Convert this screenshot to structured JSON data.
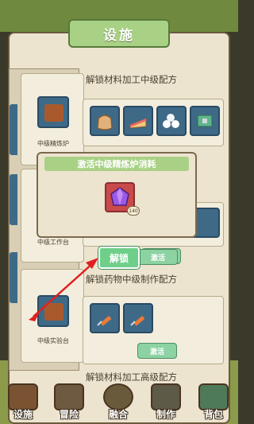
{
  "header": {
    "title": "设施"
  },
  "facilities": [
    {
      "label": "中级精炼炉"
    },
    {
      "label": "中级工作台"
    },
    {
      "label": "中级实验台"
    }
  ],
  "recipes": [
    {
      "title": "解锁材料加工中级配方"
    },
    {
      "title": "解锁药物中级制作配方",
      "activate_label": "激活"
    },
    {
      "title": "解锁材料加工高级配方"
    }
  ],
  "recipe2_activate": "激活",
  "popup": {
    "title": "激活中级精炼炉消耗",
    "item_icon": "purple-gem-icon",
    "count": "140",
    "unlock_label": "解锁",
    "activate_label": "激活"
  },
  "nav": [
    {
      "label": "设施",
      "icon": "facility-icon"
    },
    {
      "label": "冒险",
      "icon": "adventure-icon"
    },
    {
      "label": "融合",
      "icon": "fusion-icon"
    },
    {
      "label": "制作",
      "icon": "craft-icon"
    },
    {
      "label": "背包",
      "icon": "backpack-icon"
    }
  ],
  "colors": {
    "accent_green": "#a9d186",
    "slot_blue": "#3e6a88",
    "button_green": "#6fcf8a",
    "arrow_red": "#e02020"
  }
}
